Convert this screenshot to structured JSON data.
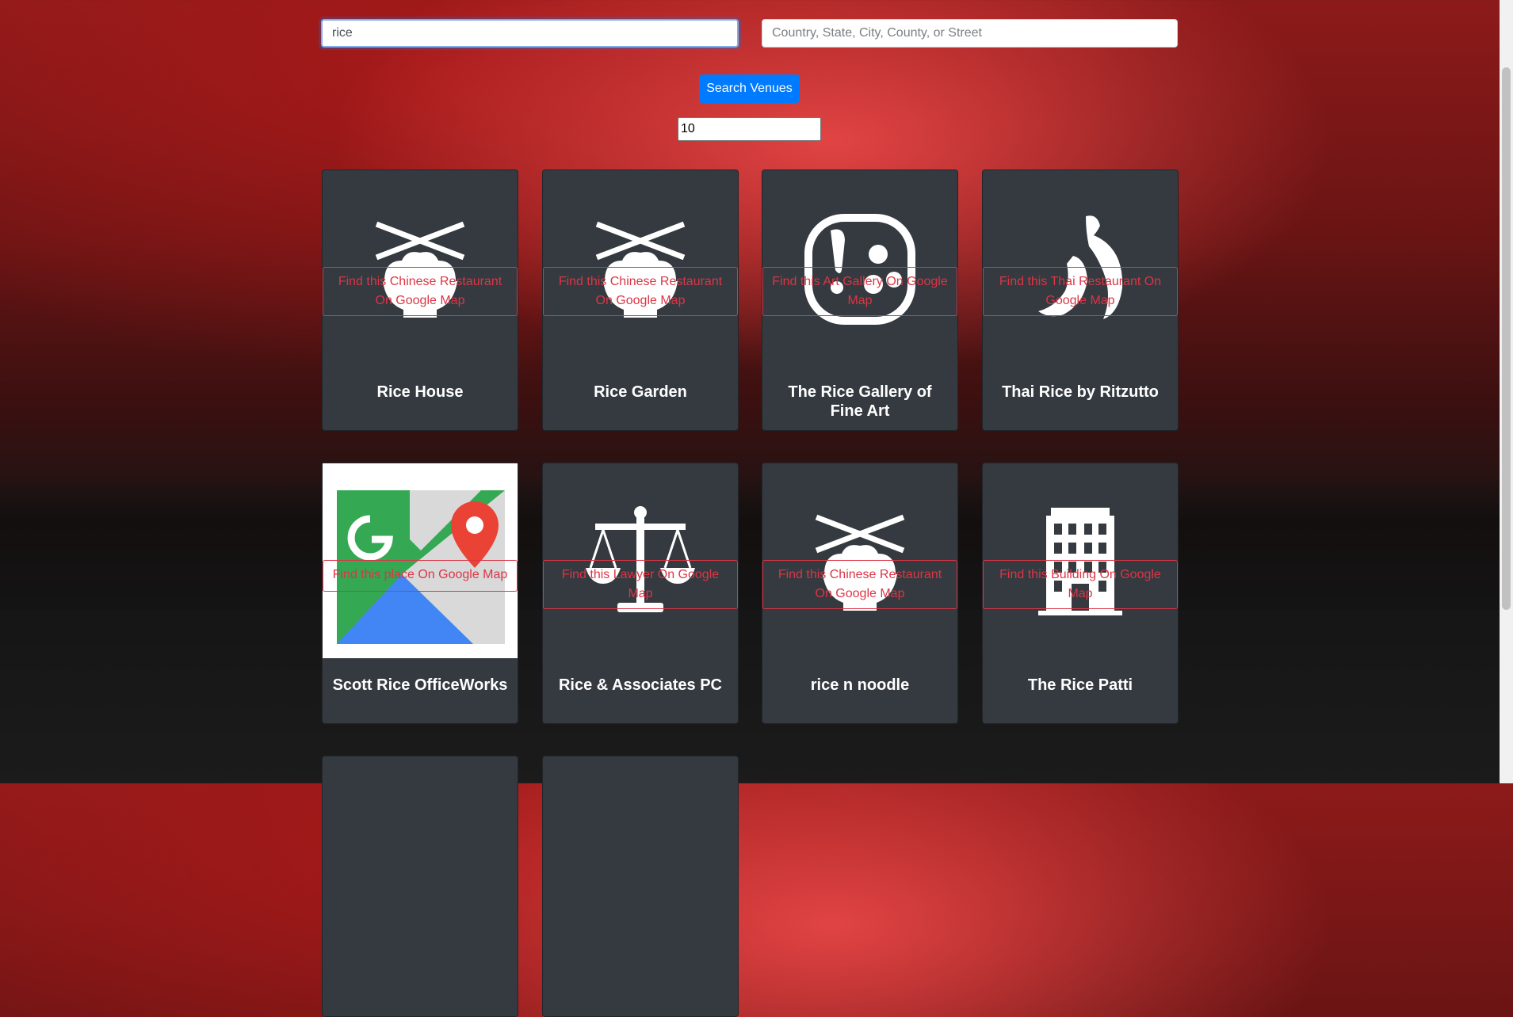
{
  "search": {
    "query_value": "rice",
    "location_placeholder": "Country, State, City, County, or Street",
    "button_label": "Search Venues",
    "limit_value": "10"
  },
  "venues": [
    {
      "name": "Rice House",
      "link": "Find this Chinese Restaurant On Google Map",
      "icon": "chopsticks-bowl-icon"
    },
    {
      "name": "Rice Garden",
      "link": "Find this Chinese Restaurant On Google Map",
      "icon": "chopsticks-bowl-icon"
    },
    {
      "name": "The Rice Gallery of Fine Art",
      "link": "Find this Art Gallery On Google Map",
      "icon": "palette-icon"
    },
    {
      "name": "Thai Rice by Ritzutto",
      "link": "Find this Thai Restaurant On Google Map",
      "icon": "chili-pepper-icon"
    },
    {
      "name": "Scott Rice OfficeWorks",
      "link": "Find this place On Google Map",
      "icon": "google-maps-icon"
    },
    {
      "name": "Rice & Associates PC",
      "link": "Find this Lawyer On Google Map",
      "icon": "scales-icon"
    },
    {
      "name": "rice n noodle",
      "link": "Find this Chinese Restaurant On Google Map",
      "icon": "chopsticks-bowl-icon"
    },
    {
      "name": "The Rice Patti",
      "link": "Find this Building On Google Map",
      "icon": "building-icon"
    }
  ],
  "colors": {
    "primary": "#007bff",
    "danger": "#dc3545",
    "card_bg": "#343a40"
  }
}
